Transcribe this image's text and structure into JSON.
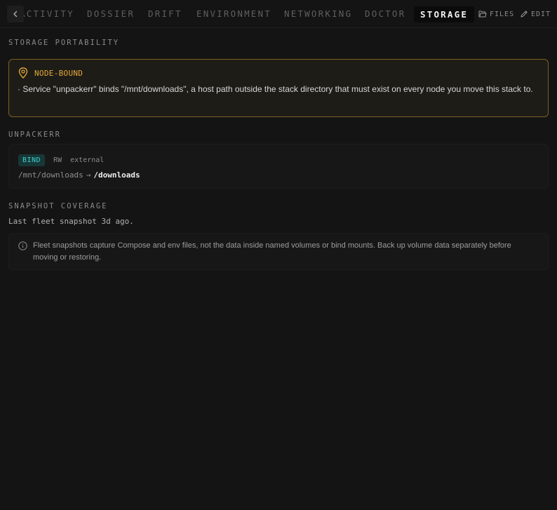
{
  "tabs": [
    {
      "label": "ACTIVITY",
      "active": false
    },
    {
      "label": "DOSSIER",
      "active": false
    },
    {
      "label": "DRIFT",
      "active": false
    },
    {
      "label": "ENVIRONMENT",
      "active": false
    },
    {
      "label": "NETWORKING",
      "active": false
    },
    {
      "label": "DOCTOR",
      "active": false
    },
    {
      "label": "STORAGE",
      "active": true
    }
  ],
  "actions": {
    "files_label": "FILES",
    "edit_label": "EDIT"
  },
  "portability": {
    "title": "STORAGE PORTABILITY",
    "warning": {
      "label": "NODE-BOUND",
      "text": "· Service \"unpackerr\" binds \"/mnt/downloads\", a host path outside the stack directory that must exist on every node you move this stack to.",
      "accent": "#e3a83a"
    }
  },
  "service": {
    "name": "UNPACKERR",
    "mounts": [
      {
        "type": "BIND",
        "mode": "RW",
        "scope": "external",
        "source": "/mnt/downloads",
        "arrow": "→",
        "target": "/downloads"
      }
    ]
  },
  "snapshot": {
    "title": "SNAPSHOT COVERAGE",
    "status": "Last fleet snapshot 3d ago.",
    "note": "Fleet snapshots capture Compose and env files, not the data inside named volumes or bind mounts. Back up volume data separately before moving or restoring."
  },
  "icons": {
    "back": "chevron-left-icon",
    "files": "folder-icon",
    "edit": "pencil-icon",
    "warning": "map-pin-icon",
    "info": "info-icon"
  }
}
